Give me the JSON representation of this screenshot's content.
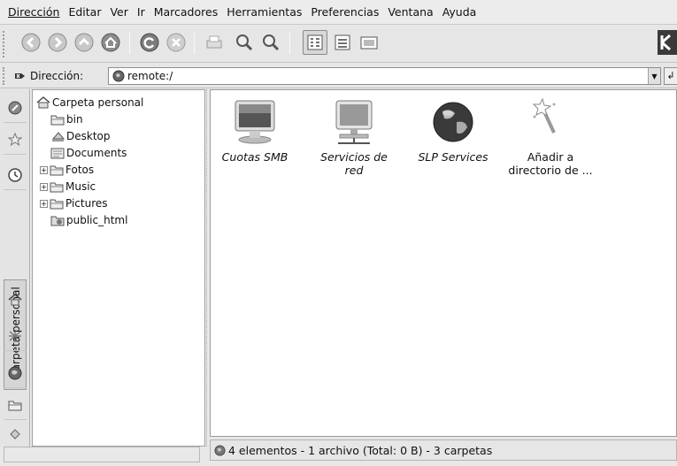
{
  "menubar": {
    "items": [
      "Dirección",
      "Editar",
      "Ver",
      "Ir",
      "Marcadores",
      "Herramientas",
      "Preferencias",
      "Ventana",
      "Ayuda"
    ]
  },
  "toolbar": {
    "buttons": [
      "back-icon",
      "forward-icon",
      "up-icon",
      "home-icon",
      "reload-icon",
      "stop-icon",
      "print-icon",
      "zoom-in-icon",
      "zoom-out-icon",
      "icon-view-icon",
      "detail-view-icon",
      "preview-icon"
    ]
  },
  "location": {
    "label": "Dirección:",
    "value": "remote:/"
  },
  "sidebar": {
    "vertical_tab_label": "Carpeta personal",
    "tabs": [
      "navigation-icon",
      "bookmarks-icon",
      "history-icon",
      "home-icon",
      "network-icon",
      "services-icon",
      "folder-icon",
      "media-icon"
    ]
  },
  "tree": {
    "root": "Carpeta personal",
    "items": [
      {
        "label": "bin",
        "expandable": false
      },
      {
        "label": "Desktop",
        "expandable": false
      },
      {
        "label": "Documents",
        "expandable": false
      },
      {
        "label": "Fotos",
        "expandable": true
      },
      {
        "label": "Music",
        "expandable": true
      },
      {
        "label": "Pictures",
        "expandable": true
      },
      {
        "label": "public_html",
        "expandable": false
      }
    ]
  },
  "main": {
    "items": [
      {
        "label": "Cuotas SMB",
        "icon": "monitor-icon"
      },
      {
        "label": "Servicios de red",
        "icon": "network-computer-icon"
      },
      {
        "label": "SLP Services",
        "icon": "globe-icon"
      },
      {
        "label": "Añadir a directorio de ...",
        "icon": "wizard-wand-icon"
      }
    ]
  },
  "status": {
    "text": "4 elementos - 1 archivo (Total: 0 B) - 3 carpetas"
  }
}
